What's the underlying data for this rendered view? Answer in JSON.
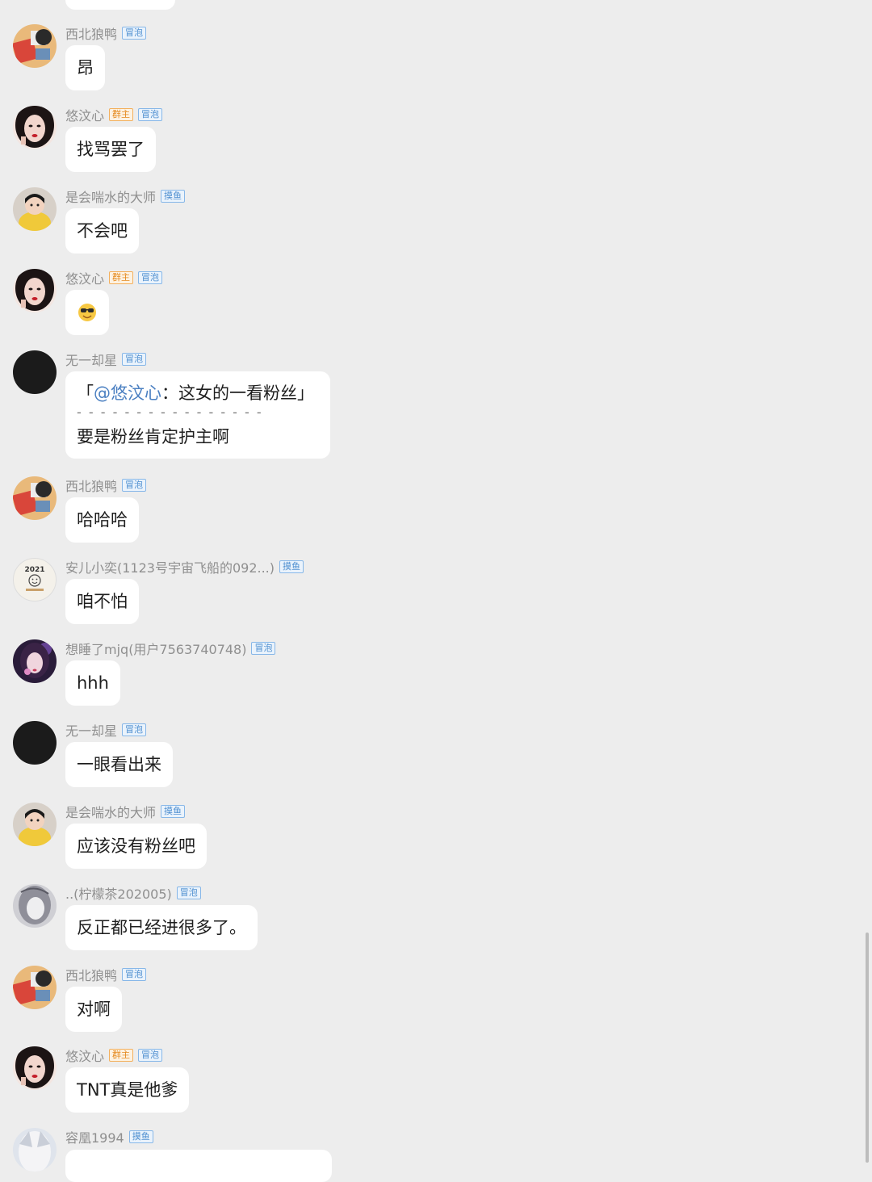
{
  "messages": [
    {
      "sender": "西北狼鸭",
      "badges": [
        {
          "label": "冒泡",
          "type": "role"
        }
      ],
      "text": "昂",
      "avatar": "red-cube-avatar"
    },
    {
      "sender": "悠汶心",
      "badges": [
        {
          "label": "群主",
          "type": "owner"
        },
        {
          "label": "冒泡",
          "type": "role"
        }
      ],
      "text": "找骂罢了",
      "avatar": "woman-portrait-avatar"
    },
    {
      "sender": "是会喘水的大师",
      "badges": [
        {
          "label": "摸鱼",
          "type": "role"
        }
      ],
      "text": "不会吧",
      "avatar": "child-yellow-avatar"
    },
    {
      "sender": "悠汶心",
      "badges": [
        {
          "label": "群主",
          "type": "owner"
        },
        {
          "label": "冒泡",
          "type": "role"
        }
      ],
      "text": "",
      "emoji": "😎",
      "avatar": "woman-portrait-avatar"
    },
    {
      "sender": "无一却星",
      "badges": [
        {
          "label": "冒泡",
          "type": "role"
        }
      ],
      "quote_open": "「",
      "quote_mention": "@悠汶心",
      "quote_text": "：这女的一看粉丝」",
      "divider": "- - - - - - - - - - - - - - - -",
      "text": "要是粉丝肯定护主啊",
      "avatar": "black-circle-avatar"
    },
    {
      "sender": "西北狼鸭",
      "badges": [
        {
          "label": "冒泡",
          "type": "role"
        }
      ],
      "text": "哈哈哈",
      "avatar": "red-cube-avatar"
    },
    {
      "sender": "安儿小奕(1123号宇宙飞船的092...)",
      "badges": [
        {
          "label": "摸鱼",
          "type": "role"
        }
      ],
      "text": "咱不怕",
      "avatar": "year-sticker-avatar",
      "avatar_text": "2021"
    },
    {
      "sender": "想睡了mjq(用户7563740748)",
      "badges": [
        {
          "label": "冒泡",
          "type": "role"
        }
      ],
      "text": "hhh",
      "avatar": "purple-girl-avatar"
    },
    {
      "sender": "无一却星",
      "badges": [
        {
          "label": "冒泡",
          "type": "role"
        }
      ],
      "text": "一眼看出来",
      "avatar": "black-circle-avatar"
    },
    {
      "sender": "是会喘水的大师",
      "badges": [
        {
          "label": "摸鱼",
          "type": "role"
        }
      ],
      "text": "应该没有粉丝吧",
      "avatar": "child-yellow-avatar"
    },
    {
      "sender": "..(柠檬茶202005)",
      "badges": [
        {
          "label": "冒泡",
          "type": "role"
        }
      ],
      "text": "反正都已经进很多了。",
      "avatar": "sketch-girl-avatar"
    },
    {
      "sender": "西北狼鸭",
      "badges": [
        {
          "label": "冒泡",
          "type": "role"
        }
      ],
      "text": "对啊",
      "avatar": "red-cube-avatar"
    },
    {
      "sender": "悠汶心",
      "badges": [
        {
          "label": "群主",
          "type": "owner"
        },
        {
          "label": "冒泡",
          "type": "role"
        }
      ],
      "text": "TNT真是他爹",
      "avatar": "woman-portrait-avatar"
    },
    {
      "sender": "容凰1994",
      "badges": [
        {
          "label": "摸鱼",
          "type": "role"
        }
      ],
      "text": "",
      "avatar": "anime-white-avatar"
    }
  ]
}
